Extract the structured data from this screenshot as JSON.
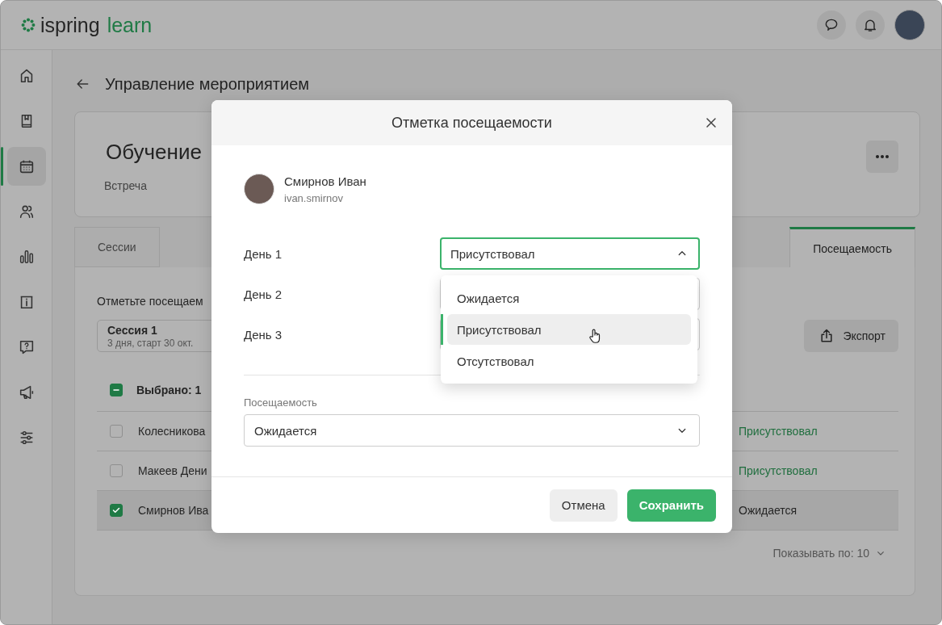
{
  "header": {
    "brand": "ispring",
    "product": "learn"
  },
  "sidebar": {
    "items": [
      {
        "selected": false
      },
      {
        "selected": false
      },
      {
        "selected": true
      },
      {
        "selected": false
      },
      {
        "selected": false
      },
      {
        "selected": false
      },
      {
        "selected": false
      },
      {
        "selected": false
      },
      {
        "selected": false
      }
    ]
  },
  "page": {
    "title": "Управление мероприятием",
    "card": {
      "title": "Обучение",
      "subtitle": "Встреча"
    },
    "tabs": [
      {
        "label": "Сессии",
        "selected": false
      },
      {
        "label": "Посещаемость",
        "selected": true
      }
    ],
    "instruction": "Отметьте посещаем",
    "session": {
      "title": "Сессия 1",
      "subtitle": "3 дня, старт 30 окт."
    },
    "export_button": "Экспорт",
    "table": {
      "select_all": {
        "indeterminate": true
      },
      "selection_label": "Выбрано: 1",
      "rows": [
        {
          "name": "Колесникова",
          "checked": false,
          "selected": false,
          "status": "Присутствовал",
          "kind": "present"
        },
        {
          "name": "Макеев Дени",
          "checked": false,
          "selected": false,
          "status": "Присутствовал",
          "kind": "present"
        },
        {
          "name": "Смирнов Ива",
          "checked": true,
          "selected": true,
          "status": "Ожидается",
          "kind": "pending"
        }
      ]
    },
    "page_size": "Показывать по: 10"
  },
  "modal": {
    "title": "Отметка посещаемости",
    "user": {
      "name": "Смирнов Иван",
      "login": "ivan.smirnov"
    },
    "days": [
      {
        "label": "День 1",
        "value": "Присутствовал",
        "expanded": true
      },
      {
        "label": "День 2",
        "expanded": false
      },
      {
        "label": "День 3",
        "expanded": false
      }
    ],
    "options": [
      {
        "label": "Ожидается",
        "selected": false
      },
      {
        "label": "Присутствовал",
        "selected": true
      },
      {
        "label": "Отсутствовал",
        "selected": false
      }
    ],
    "attendance": {
      "label": "Посещаемость",
      "value": "Ожидается"
    },
    "cancel_button": "Отмена",
    "save_button": "Сохранить"
  }
}
